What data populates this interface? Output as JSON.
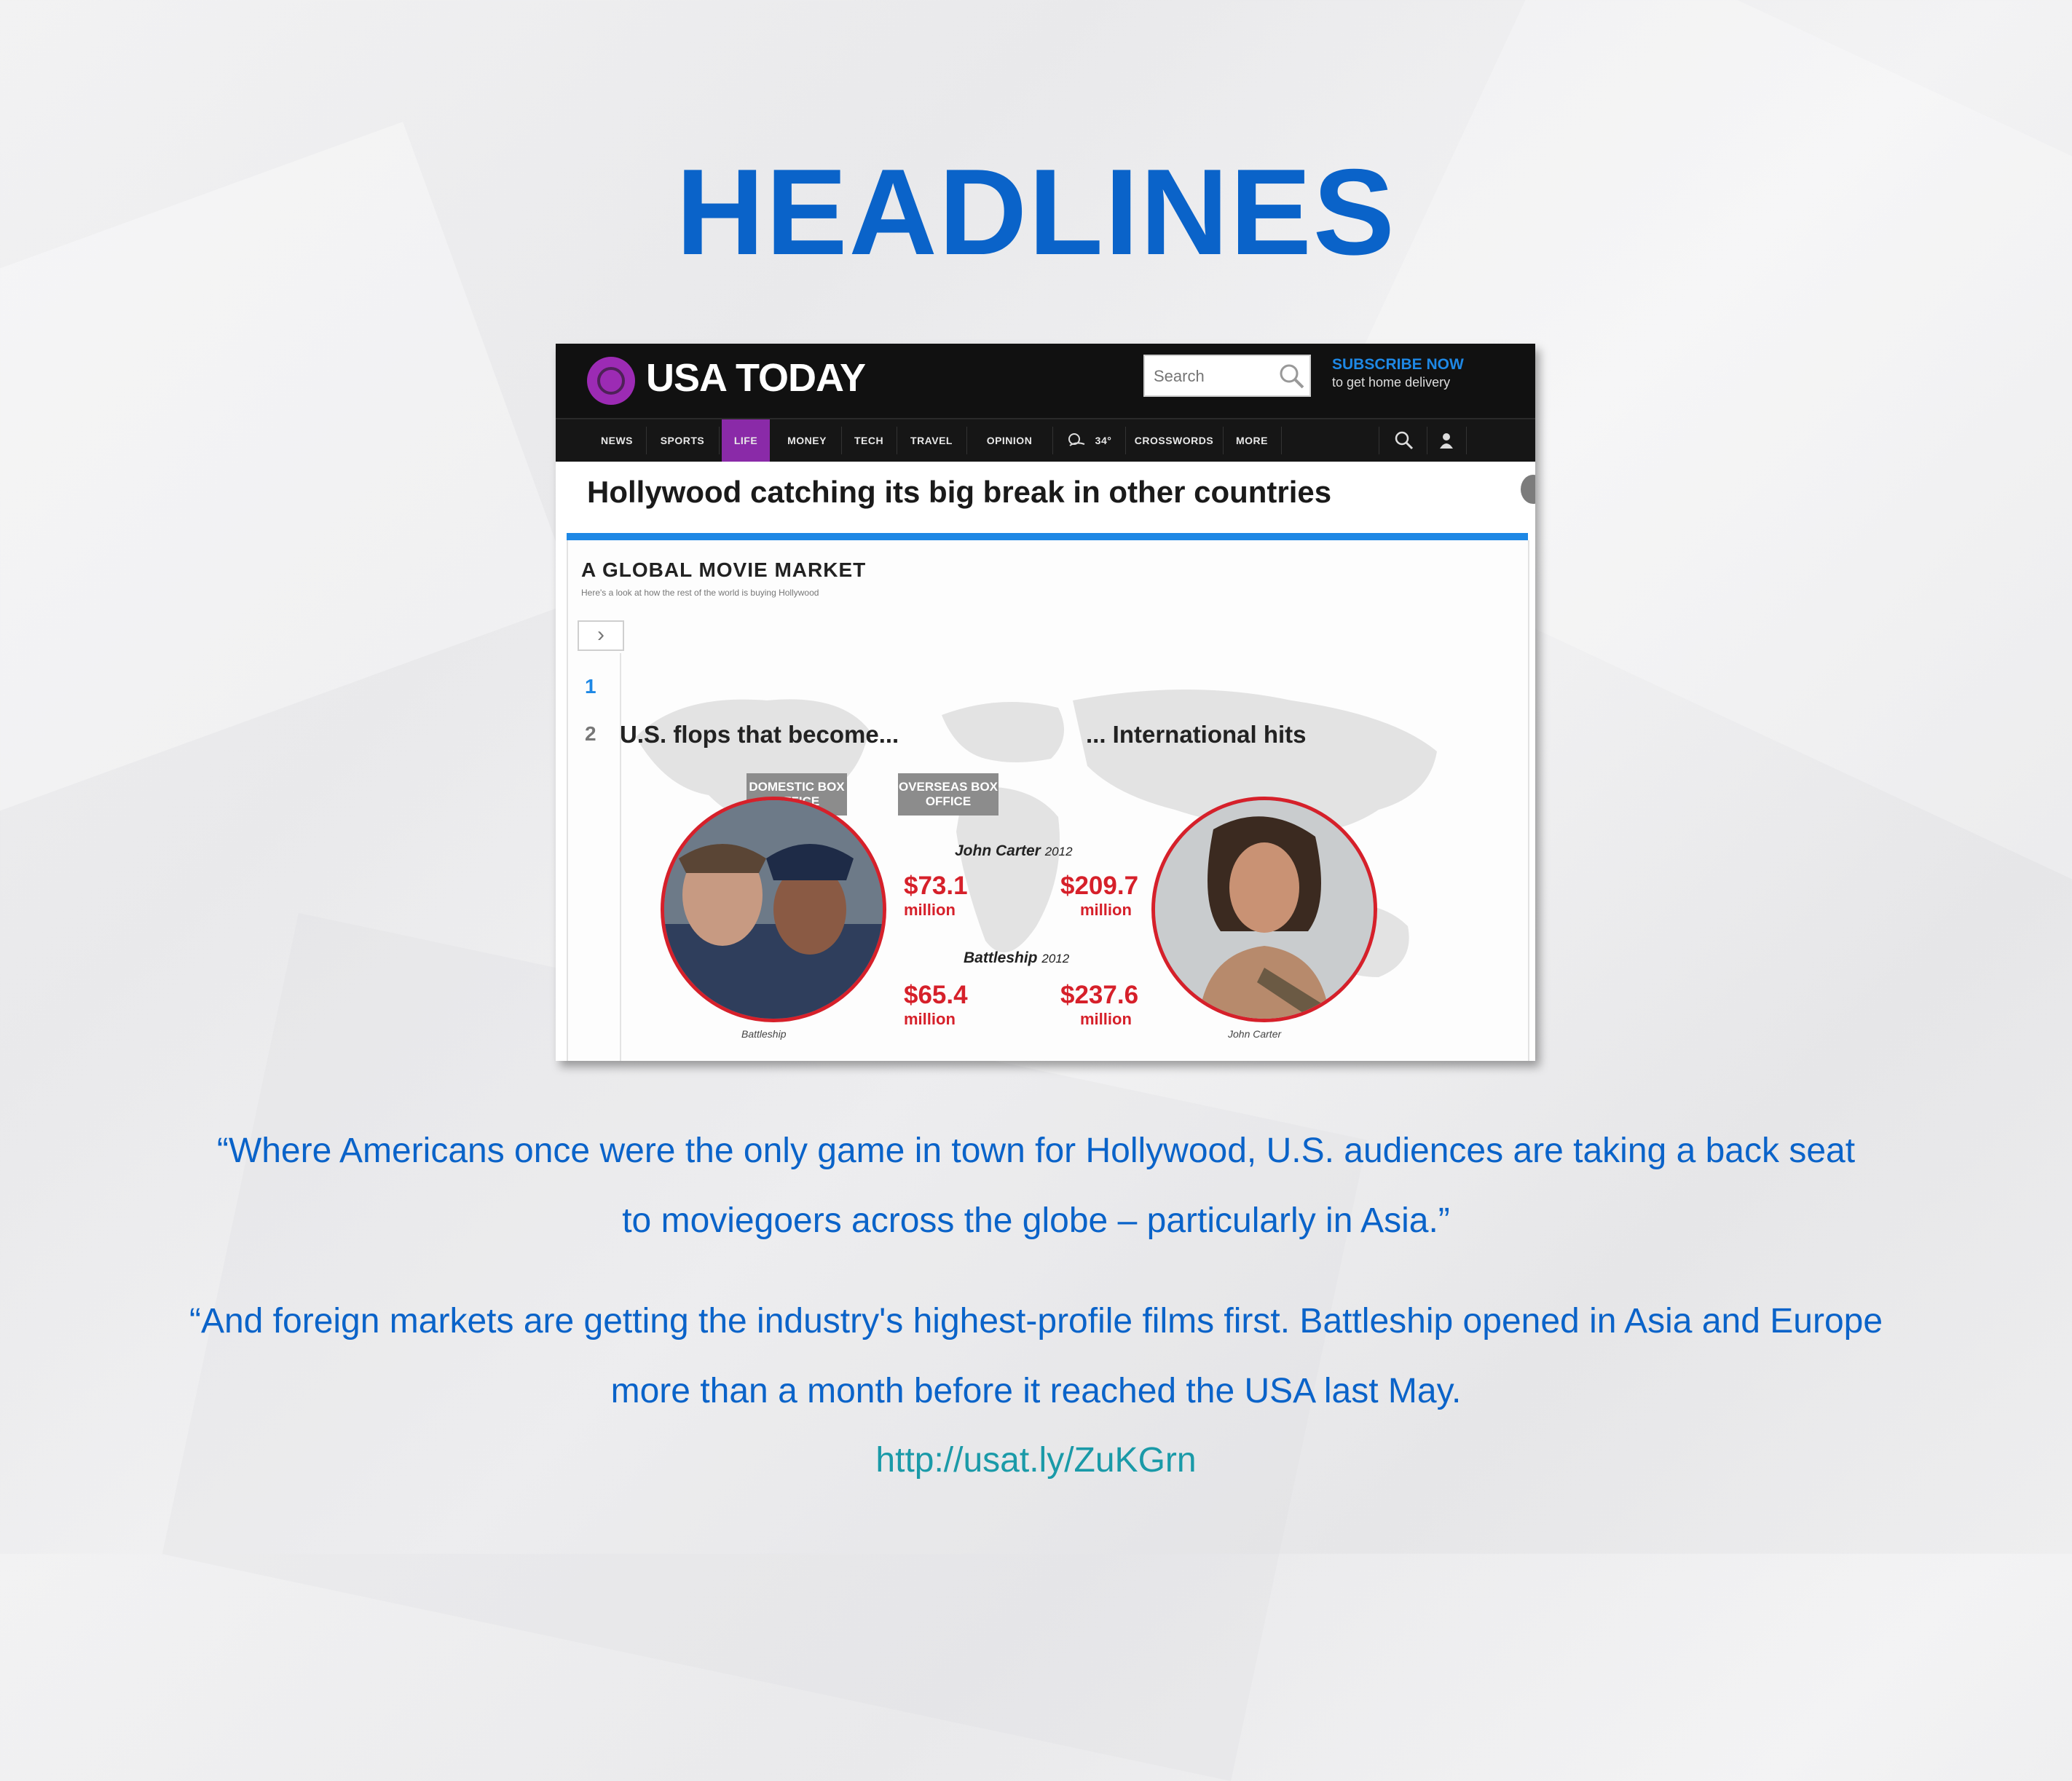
{
  "slide": {
    "title": "HEADLINES"
  },
  "site": {
    "logo_text": "USA TODAY",
    "search_placeholder": "Search",
    "subscribe_title": "SUBSCRIBE NOW",
    "subscribe_sub": "to get home delivery",
    "nav": [
      "NEWS",
      "SPORTS",
      "LIFE",
      "MONEY",
      "TECH",
      "TRAVEL",
      "OPINION",
      "34°",
      "CROSSWORDS",
      "MORE"
    ],
    "nav_active": "LIFE",
    "brand_color": "#9c2bb4",
    "accent_color": "#1e88e5"
  },
  "article": {
    "headline": "Hollywood catching its big break in other countries",
    "graphic_title": "A GLOBAL MOVIE MARKET",
    "graphic_subtitle": "Here's a look at how the rest of the world is buying Hollywood",
    "pages": [
      "1",
      "2"
    ],
    "left_heading": "U.S. flops that become...",
    "right_heading": "... International hits",
    "domestic_label": "DOMESTIC BOX OFFICE",
    "overseas_label": "OVERSEAS BOX OFFICE",
    "films": [
      {
        "title": "John Carter",
        "year": "2012",
        "domestic": "$73.1",
        "overseas": "$209.7",
        "unit": "million"
      },
      {
        "title": "Battleship",
        "year": "2012",
        "domestic": "$65.4",
        "overseas": "$237.6",
        "unit": "million"
      }
    ],
    "left_caption": "Battleship",
    "right_caption": "John Carter",
    "highlight_color": "#d6202a"
  },
  "quotes": {
    "q1_line1": "“Where Americans once were the only game in town for Hollywood, U.S. audiences are taking a back seat",
    "q1_line2": "to moviegoers across the globe – particularly in Asia.”",
    "q2_line1": "“And foreign markets are getting the industry's highest-profile films first. Battleship opened in Asia and Europe",
    "q2_line2": "more than a month before it reached the USA last May.",
    "link": "http://usat.ly/ZuKGrn"
  }
}
